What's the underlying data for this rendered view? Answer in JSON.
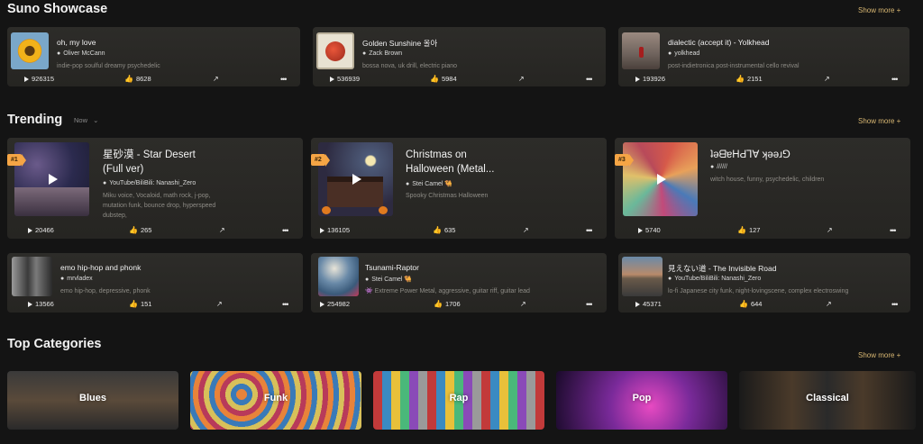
{
  "showcase": {
    "title": "Suno Showcase",
    "show_more": "Show more +",
    "cards": [
      {
        "title": "oh, my love",
        "user": "Oliver McCann",
        "tags": "indie-pop soulful dreamy psychedelic",
        "plays": "926315",
        "likes": "8628"
      },
      {
        "title": "Golden Sunshine 올아",
        "user": "Zack Brown",
        "tags": "bossa nova, uk drill, electric piano",
        "plays": "536939",
        "likes": "5984"
      },
      {
        "title": "dialectic (accept it) - Yolkhead",
        "user": "yolkhead",
        "tags": "post-indietronica post-instrumental cello revival",
        "plays": "193926",
        "likes": "2151"
      }
    ]
  },
  "trending": {
    "title": "Trending",
    "filter": "Now",
    "show_more": "Show more +",
    "big_cards": [
      {
        "rank": "#1",
        "title_line1": "星砂漠 - Star Desert",
        "title_line2": "(Full ver)",
        "user": "YouTube/BiliBili: Nanashi_Zero",
        "tags": "Miku voice, Vocaloid, math rock, j-pop, mutation funk, bounce drop, hyperspeed dubstep,",
        "plays": "20466",
        "likes": "265"
      },
      {
        "rank": "#2",
        "title_line1": "Christmas on",
        "title_line2": "Halloween (Metal...",
        "user": "Stei Camel 🐫",
        "tags": "Spooky Christmas Halloween",
        "plays": "136105",
        "likes": "635"
      },
      {
        "rank": "#3",
        "title_line1": "ʇǝᗺɐHԀ⅂∀ ʞǝǝɹ⅁",
        "title_line2": "",
        "user": "//////",
        "tags": "witch house, funny, psychedelic, children",
        "plays": "5740",
        "likes": "127"
      }
    ],
    "small_cards": [
      {
        "title": "emo hip-hop and phonk",
        "user": "mrvladex",
        "tags": "emo hip-hop, depressive, phonk",
        "plays": "13566",
        "likes": "151"
      },
      {
        "title": "Tsunami-Raptor",
        "user": "Stei Camel 🐫",
        "tags": "👾 Extreme Power Metal, aggressive, guitar riff, guitar lead",
        "plays": "254982",
        "likes": "1706"
      },
      {
        "title": "見えない道 - The Invisible Road",
        "user": "YouTube/BiliBili: Nanashi_Zero",
        "tags": "lo-fi Japanese city funk, night-lovingscene, complex electroswing",
        "plays": "45371",
        "likes": "644"
      }
    ]
  },
  "categories": {
    "title": "Top Categories",
    "show_more": "Show more +",
    "items": [
      "Blues",
      "Funk",
      "Rap",
      "Pop",
      "Classical"
    ]
  },
  "icons": {
    "play": "play-icon",
    "like": "thumbs-up-icon",
    "share": "share-icon",
    "more": "more-icon",
    "user": "user-icon",
    "chevron": "chevron-down-icon"
  },
  "colors": {
    "accent": "#d8b772",
    "rank_badge": "#f5a545",
    "background": "#141414",
    "card": "#2b2a27"
  }
}
